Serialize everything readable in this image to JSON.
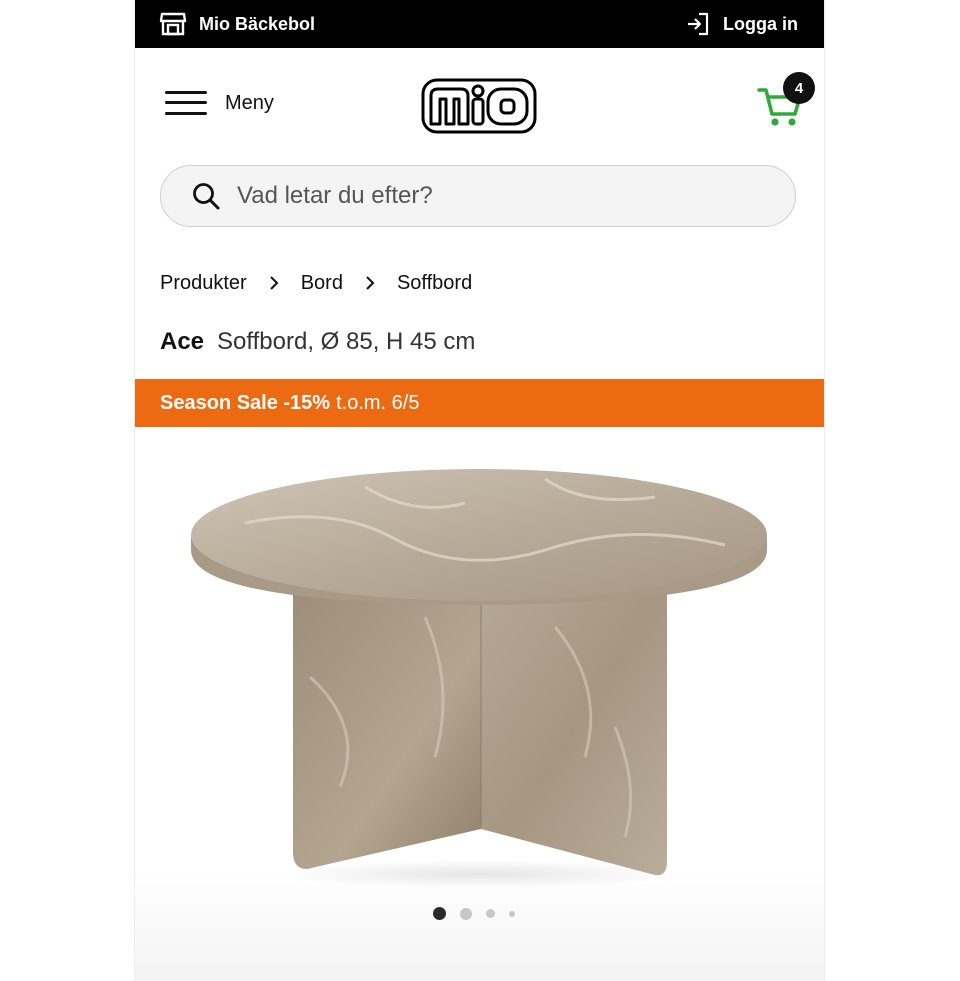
{
  "topbar": {
    "store_name": "Mio Bäckebol",
    "login_label": "Logga in"
  },
  "header": {
    "menu_label": "Meny",
    "logo_text": "mio",
    "cart_count": "4",
    "cart_color": "#2faa3a"
  },
  "search": {
    "placeholder": "Vad letar du efter?"
  },
  "breadcrumb": [
    "Produkter",
    "Bord",
    "Soffbord"
  ],
  "product": {
    "brand": "Ace",
    "description": "Soffbord, Ø 85, H 45 cm"
  },
  "sale": {
    "label": "Season Sale -15%",
    "until": "t.o.m. 6/5",
    "color": "#ec6a12"
  },
  "gallery": {
    "image_count": 4,
    "active_index": 0
  }
}
